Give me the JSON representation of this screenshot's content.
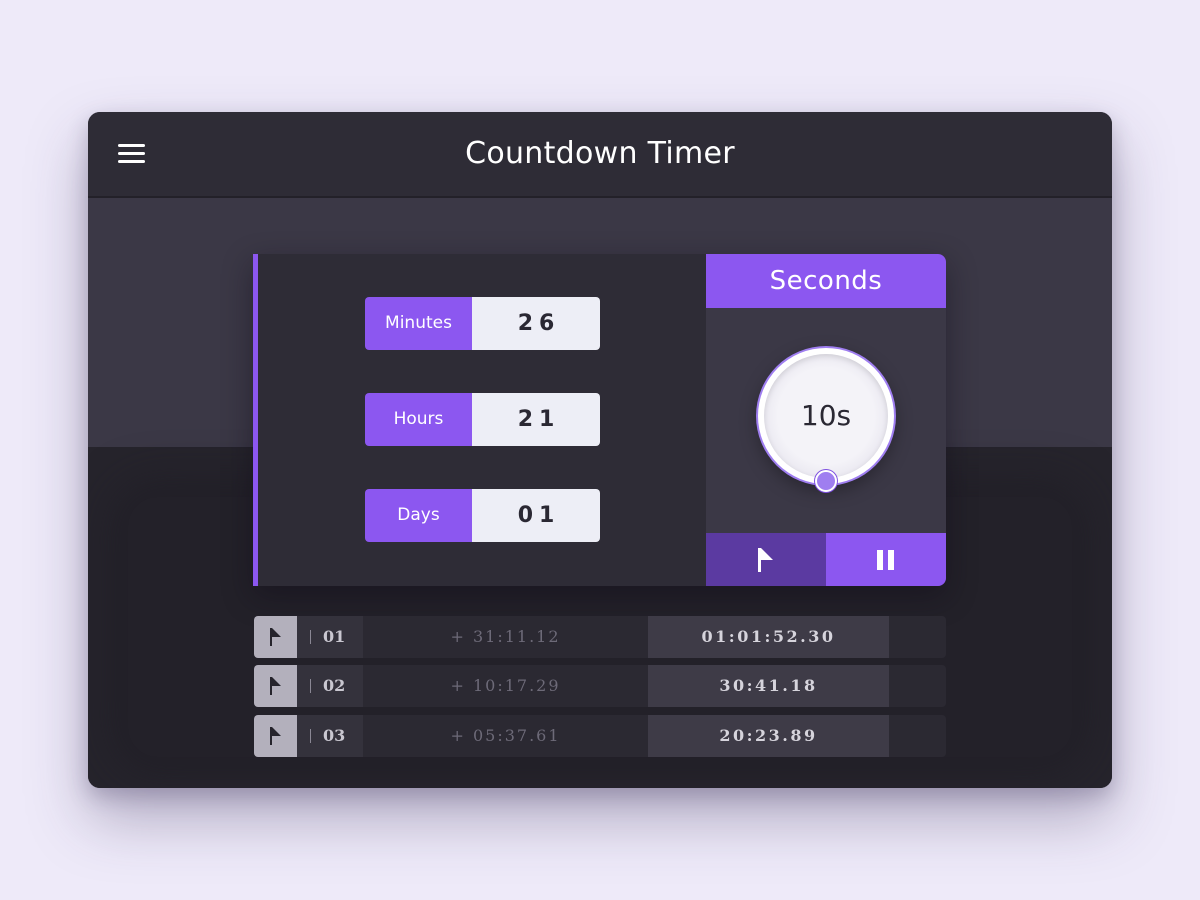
{
  "header": {
    "title": "Countdown Timer",
    "menu_icon": "hamburger-menu-icon"
  },
  "fields": [
    {
      "label": "Minutes",
      "value": "26"
    },
    {
      "label": "Hours",
      "value": "21"
    },
    {
      "label": "Days",
      "value": "01"
    }
  ],
  "seconds": {
    "title": "Seconds",
    "value": "10s"
  },
  "controls": {
    "flag_icon": "flag-icon",
    "pause_icon": "pause-icon"
  },
  "laps": [
    {
      "number": "01",
      "split": "+ 31:11.12",
      "total": "01:01:52.30"
    },
    {
      "number": "02",
      "split": "+ 10:17.29",
      "total": "30:41.18"
    },
    {
      "number": "03",
      "split": "+ 05:37.61",
      "total": "20:23.89"
    }
  ],
  "colors": {
    "accent": "#8c57f0",
    "accent_dark": "#5b3aa1",
    "background": "#eeeaf9",
    "panel": "#2e2c36"
  }
}
